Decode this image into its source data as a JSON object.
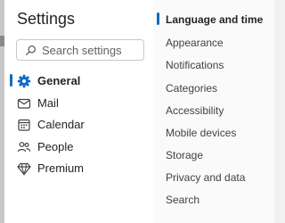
{
  "settings": {
    "title": "Settings",
    "search": {
      "placeholder": "Search settings",
      "value": ""
    },
    "nav": [
      {
        "label": "General",
        "icon": "gear-icon",
        "selected": true
      },
      {
        "label": "Mail",
        "icon": "mail-icon",
        "selected": false
      },
      {
        "label": "Calendar",
        "icon": "calendar-icon",
        "selected": false
      },
      {
        "label": "People",
        "icon": "people-icon",
        "selected": false
      },
      {
        "label": "Premium",
        "icon": "diamond-icon",
        "selected": false
      }
    ],
    "categories": [
      {
        "label": "Language and time",
        "selected": true
      },
      {
        "label": "Appearance",
        "selected": false
      },
      {
        "label": "Notifications",
        "selected": false
      },
      {
        "label": "Categories",
        "selected": false
      },
      {
        "label": "Accessibility",
        "selected": false
      },
      {
        "label": "Mobile devices",
        "selected": false
      },
      {
        "label": "Storage",
        "selected": false
      },
      {
        "label": "Privacy and data",
        "selected": false
      },
      {
        "label": "Search",
        "selected": false
      }
    ]
  },
  "colors": {
    "accent": "#0f6cbd",
    "pane_left": "#ffffff",
    "pane_right": "#fafafa"
  }
}
